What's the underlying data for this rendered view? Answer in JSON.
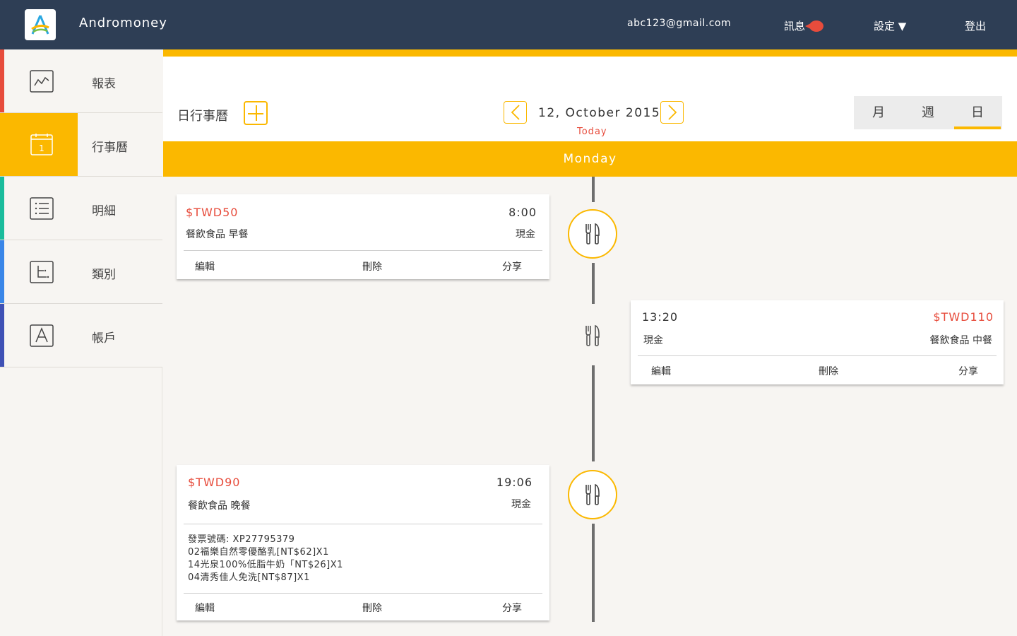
{
  "app": {
    "title": "Andromoney",
    "email": "abc123@gmail.com",
    "messages_label": "訊息",
    "settings_label": "設定 ▼",
    "logout_label": "登出"
  },
  "sidebar": {
    "items": [
      {
        "label": "報表",
        "icon": "chart-line-icon",
        "color": "#e74c3c"
      },
      {
        "label": "行事曆",
        "icon": "calendar-icon",
        "color": "#fbb800",
        "active": true
      },
      {
        "label": "明細",
        "icon": "list-icon",
        "color": "#1abc9c"
      },
      {
        "label": "類別",
        "icon": "category-icon",
        "color": "#3a86e8"
      },
      {
        "label": "帳戶",
        "icon": "account-icon",
        "color": "#3f51b5"
      }
    ]
  },
  "calendar": {
    "title": "日行事曆",
    "date": "12, October 2015",
    "today": "Today",
    "views": [
      "月",
      "週",
      "日"
    ],
    "active_view": "日",
    "weekday": "Monday"
  },
  "entries": [
    {
      "amount": "$TWD50",
      "time": "8:00",
      "category": "餐飲食品 早餐",
      "account": "現金",
      "edit": "編輯",
      "delete": "刪除",
      "share": "分享"
    },
    {
      "amount": "$TWD110",
      "time": "13:20",
      "category": "餐飲食品 中餐",
      "account": "現金",
      "edit": "編輯",
      "delete": "刪除",
      "share": "分享"
    },
    {
      "amount": "$TWD90",
      "time": "19:06",
      "category": "餐飲食品 晚餐",
      "account": "現金",
      "notes": [
        "發票號碼: XP27795379",
        "02福樂自然零優酪乳[NT$62]X1",
        "14光泉100%低脂牛奶「NT$26]X1",
        "04清秀佳人免洗[NT$87]X1"
      ],
      "edit": "編輯",
      "delete": "刪除",
      "share": "分享"
    }
  ],
  "colors": {
    "accent": "#fbb800",
    "header": "#2e3e55",
    "amount": "#e74c3c"
  }
}
